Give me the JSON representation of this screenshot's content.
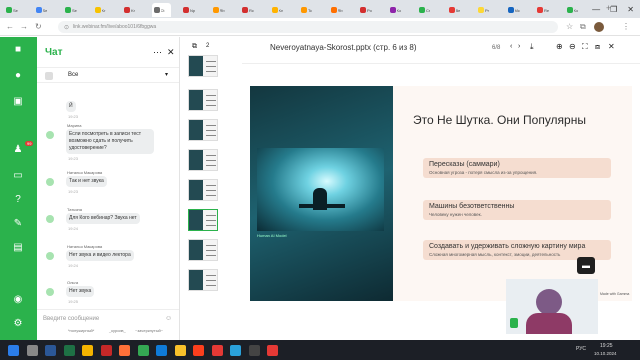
{
  "browser": {
    "tabs": [
      {
        "label": "Se",
        "color": "#2bb24c"
      },
      {
        "label": "Se",
        "color": "#4285f4"
      },
      {
        "label": "Se",
        "color": "#2bb24c"
      },
      {
        "label": "Kr",
        "color": "#f7c200"
      },
      {
        "label": "Kr",
        "color": "#d32f2f"
      },
      {
        "label": "Ct",
        "color": "#6b6b6b",
        "active": true
      },
      {
        "label": "Np",
        "color": "#d32f2f"
      },
      {
        "label": "Rb",
        "color": "#ff9800"
      },
      {
        "label": "Rc",
        "color": "#d32f2f"
      },
      {
        "label": "Kn",
        "color": "#ffb300"
      },
      {
        "label": "Tc",
        "color": "#ff9800"
      },
      {
        "label": "Rb",
        "color": "#ff6f00"
      },
      {
        "label": "Po",
        "color": "#d32f2f"
      },
      {
        "label": "Ko",
        "color": "#8e24aa"
      },
      {
        "label": "Cr",
        "color": "#2bb24c"
      },
      {
        "label": "Be",
        "color": "#e53935"
      },
      {
        "label": "Pr",
        "color": "#fdd835"
      },
      {
        "label": "Mc",
        "color": "#1565c0"
      },
      {
        "label": "Re",
        "color": "#e53935"
      },
      {
        "label": "Ko",
        "color": "#2bb24c"
      }
    ],
    "url": "link.webinar.fm/live/aboo101/6fbggwa",
    "window_controls": [
      "—",
      "❐",
      "✕"
    ]
  },
  "chat": {
    "title": "Чат",
    "room": "Все",
    "messages": [
      {
        "name": "",
        "text": "Й",
        "time": "19:23"
      },
      {
        "name": "Марина",
        "text": "Если посмотреть в записи тест возможно сдать и получить удостоверение?",
        "time": "19:23"
      },
      {
        "name": "Наталья Макарова",
        "text": "Так и нет звука",
        "time": "19:23"
      },
      {
        "name": "Татьяна",
        "text": "Для Кого вебинар? Звука нет",
        "time": "19:24"
      },
      {
        "name": "Наталья Макарова",
        "text": "Нет звука и видео лектора",
        "time": "19:24"
      },
      {
        "name": "Ольга",
        "text": "Нет звука",
        "time": "19:25"
      }
    ],
    "input_placeholder": "Введите сообщение",
    "formatting": [
      "*полужирный*",
      "_курсив_",
      "~зачеркнутый~"
    ],
    "badge": "99"
  },
  "presentation": {
    "thumbs_count": "2",
    "file_title": "Neveroyatnaya-Skorost.pptx (стр. 6 из 8)",
    "page_indicator": "6/8",
    "slide": {
      "heading": "Это Не Шутка. Они Популярны",
      "image_caption": "Human AI Model",
      "cards": [
        {
          "title": "Пересказы (саммари)",
          "sub": "Основная угроза - потеря смысла из-за упрощения."
        },
        {
          "title": "Машины безответственны",
          "sub": "Человеку нужен человек."
        },
        {
          "title": "Создавать и удерживать сложную картину мира",
          "sub": "Сложная многомерная мысль, контекст, эмоции, деятельность"
        }
      ],
      "footer_note": "Made with Gamma"
    }
  },
  "taskbar": {
    "icons": [
      {
        "name": "windows",
        "color": "#2b7de9"
      },
      {
        "name": "search",
        "color": "#888"
      },
      {
        "name": "word",
        "color": "#2b5797"
      },
      {
        "name": "excel",
        "color": "#1e7145"
      },
      {
        "name": "chrome",
        "color": "#f4b400"
      },
      {
        "name": "pdf",
        "color": "#c62828"
      },
      {
        "name": "firefox",
        "color": "#ff7139"
      },
      {
        "name": "chrome2",
        "color": "#34a853"
      },
      {
        "name": "edge",
        "color": "#0f7bd8"
      },
      {
        "name": "explorer",
        "color": "#f9c12b"
      },
      {
        "name": "yandex",
        "color": "#fc3f1d"
      },
      {
        "name": "media",
        "color": "#e53935"
      },
      {
        "name": "telegram",
        "color": "#2aa1da"
      },
      {
        "name": "obs",
        "color": "#444"
      },
      {
        "name": "recorder",
        "color": "#e53935"
      }
    ],
    "language": "РУС",
    "time": "19:25",
    "date": "10.10.2024"
  }
}
